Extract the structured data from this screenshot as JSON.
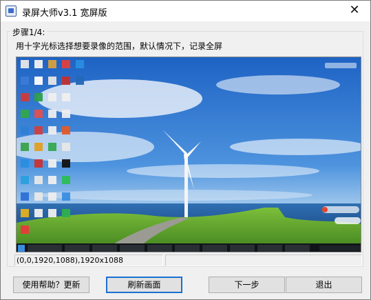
{
  "window": {
    "title": "录屏大师v3.1 宽屏版",
    "close_glyph": "✕"
  },
  "group": {
    "label": "步骤1/4:",
    "instruction": "用十字光标选择想要录像的范围，默认情况下，记录全屏"
  },
  "preview": {
    "description_icon": "desktop-screenshot-preview"
  },
  "status": {
    "selection": "(0,0,1920,1088),1920x1088",
    "secondary": ""
  },
  "buttons": {
    "help": "使用帮助？更新",
    "refresh": "刷新画面",
    "next": "下一步",
    "exit": "退出"
  }
}
